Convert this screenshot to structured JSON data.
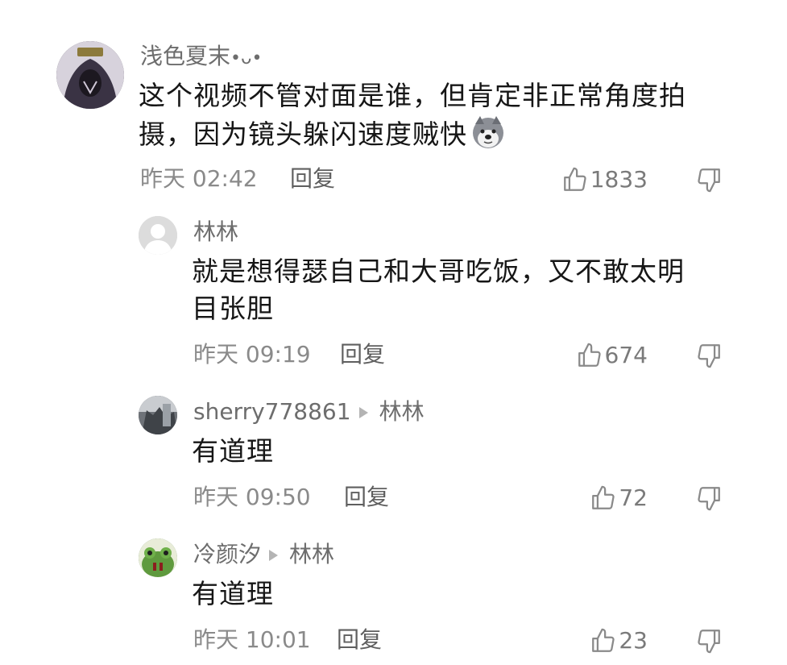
{
  "comments": [
    {
      "user": "浅色夏末",
      "user_suffix": "•ᴗ•",
      "text_line1": "这个视频不管对面是谁，但肯定非正常角度拍",
      "text_line2": "摄，因为镜头躲闪速度贼快",
      "emoji_icon": "husky-dog-emoji",
      "time": "昨天 02:42",
      "reply_label": "回复",
      "likes": "1833"
    },
    {
      "user": "林林",
      "text_line1": "就是想得瑟自己和大哥吃饭，又不敢太明",
      "text_line2": "目张胆",
      "time": "昨天 09:19",
      "reply_label": "回复",
      "likes": "674"
    },
    {
      "user": "sherry778861",
      "reply_to": "林林",
      "text_line1": "有道理",
      "time": "昨天 09:50",
      "reply_label": "回复",
      "likes": "72"
    },
    {
      "user": "冷颜汐",
      "reply_to": "林林",
      "text_line1": "有道理",
      "time": "昨天 10:01",
      "reply_label": "回复",
      "likes": "23"
    }
  ],
  "colors": {
    "name": "#6d6d6d",
    "text": "#161616",
    "meta": "#8a8a8a"
  }
}
